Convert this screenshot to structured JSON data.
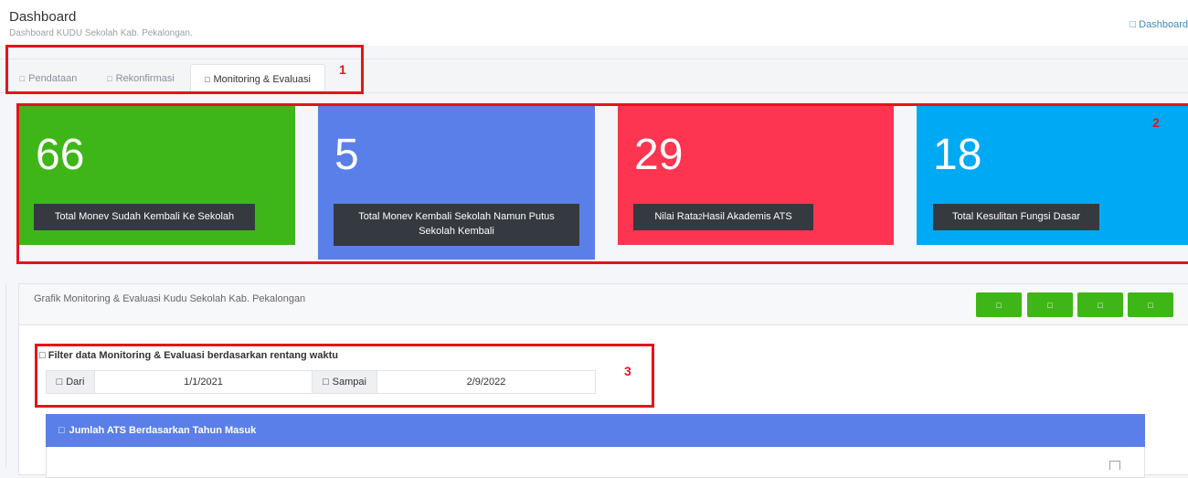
{
  "header": {
    "title": "Dashboard",
    "subtitle": "Dashboard KUDU Sekolah Kab. Pekalongan.",
    "breadcrumb": "Dashboard"
  },
  "tabs": [
    {
      "label": "Pendataan",
      "icon": "database-icon"
    },
    {
      "label": "Rekonfirmasi",
      "icon": "refresh-icon"
    },
    {
      "label": "Monitoring & Evaluasi",
      "icon": "chart-icon",
      "active": true
    }
  ],
  "cards": [
    {
      "value": "66",
      "label": "Total Monev Sudah Kembali Ke Sekolah",
      "color": "#3fb618"
    },
    {
      "value": "5",
      "label": "Total Monev Kembali Sekolah Namun Putus Sekolah Kembali",
      "color": "#5b7fe8"
    },
    {
      "value": "29",
      "label_pre": "Nilai Rata",
      "label_sup": "2",
      "label_post": " Hasil Akademis ATS",
      "color": "#fd3550"
    },
    {
      "value": "18",
      "label": "Total Kesulitan Fungsi Dasar",
      "color": "#00a9f4"
    }
  ],
  "panel": {
    "title": "Grafik Monitoring & Evaluasi Kudu Sekolah Kab. Pekalongan",
    "buttons": [
      "btn-1",
      "btn-2",
      "btn-3",
      "btn-4"
    ]
  },
  "filter": {
    "title": "Filter data Monitoring & Evaluasi berdasarkan rentang waktu",
    "from_label": "Dari",
    "from_value": "1/1/2021",
    "to_label": "Sampai",
    "to_value": "2/9/2022"
  },
  "sub_panel": {
    "title": "Jumlah ATS Berdasarkan Tahun Masuk"
  },
  "annotations": [
    "1",
    "2",
    "3"
  ],
  "glyph": "□"
}
